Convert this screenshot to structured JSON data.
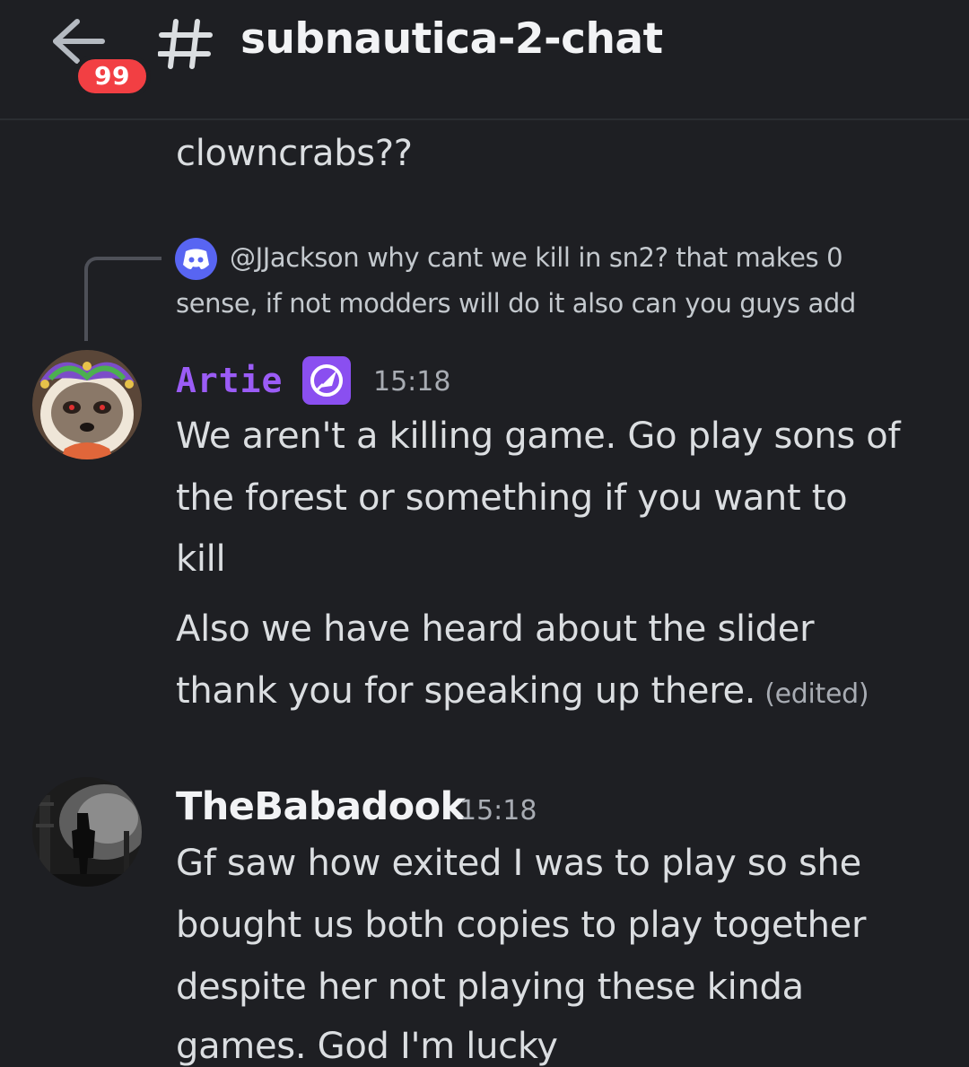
{
  "header": {
    "unread_badge": "99",
    "channel_name": "subnautica-2-chat"
  },
  "messages": {
    "previous_tail": "clowncrabs??",
    "reply_preview": {
      "username": "@JJackson",
      "line1": "why cant we kill in sn2? that makes 0",
      "line2": "sense, if not modders will do it also can you guys add"
    },
    "artie": {
      "author": "Artie",
      "timestamp": "15:18",
      "paragraph1": [
        "We aren't a killing game. Go play sons of",
        "the forest or something if you want to",
        "kill"
      ],
      "paragraph2": [
        "Also we have heard about the slider",
        "thank you for speaking up there."
      ],
      "edited_label": "(edited)"
    },
    "babadook": {
      "author": "TheBabadook",
      "timestamp": "15:18",
      "lines": [
        "Gf saw how exited I was to play so she",
        "bought us both copies to play together",
        "despite her not playing these kinda",
        "games. God I'm lucky"
      ]
    }
  },
  "colors": {
    "background": "#1e1f23",
    "unread_badge": "#f23f43",
    "artie_name": "#9b5cf6",
    "role_badge": "#8a4ff0",
    "reply_avatar": "#5865f2"
  },
  "icons": {
    "back": "arrow-left-icon",
    "channel": "hashtag-icon",
    "reply_avatar": "discord-logo-icon",
    "role": "rocket-badge-icon"
  }
}
